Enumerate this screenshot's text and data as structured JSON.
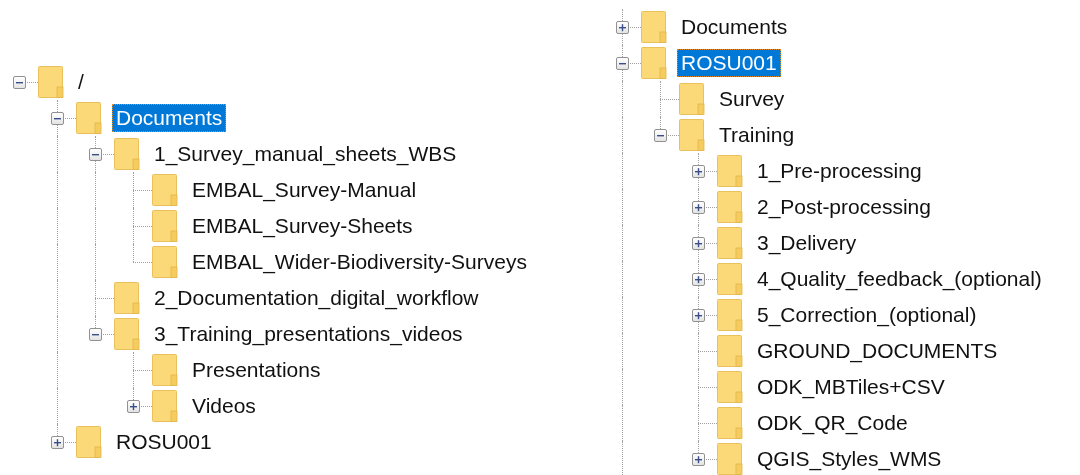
{
  "panes": [
    {
      "tree": [
        {
          "label": "/",
          "expanded": true,
          "selected": false,
          "children": [
            {
              "label": "Documents",
              "expanded": true,
              "selected": true,
              "children": [
                {
                  "label": "1_Survey_manual_sheets_WBS",
                  "expanded": true,
                  "selected": false,
                  "children": [
                    {
                      "label": "EMBAL_Survey-Manual",
                      "selected": false
                    },
                    {
                      "label": "EMBAL_Survey-Sheets",
                      "selected": false
                    },
                    {
                      "label": "EMBAL_Wider-Biodiversity-Surveys",
                      "selected": false
                    }
                  ]
                },
                {
                  "label": "2_Documentation_digital_workflow",
                  "selected": false
                },
                {
                  "label": "3_Training_presentations_videos",
                  "expanded": true,
                  "selected": false,
                  "children": [
                    {
                      "label": "Presentations",
                      "selected": false
                    },
                    {
                      "label": "Videos",
                      "expanded": false,
                      "selected": false
                    }
                  ]
                }
              ]
            },
            {
              "label": "ROSU001",
              "expanded": false,
              "selected": false
            }
          ]
        }
      ]
    },
    {
      "tree": [
        {
          "label": "Documents",
          "expanded": false,
          "selected": false
        },
        {
          "label": "ROSU001",
          "expanded": true,
          "selected": true,
          "children": [
            {
              "label": "Survey",
              "selected": false
            },
            {
              "label": "Training",
              "expanded": true,
              "selected": false,
              "children": [
                {
                  "label": "1_Pre-processing",
                  "expanded": false,
                  "selected": false
                },
                {
                  "label": "2_Post-processing",
                  "expanded": false,
                  "selected": false
                },
                {
                  "label": "3_Delivery",
                  "expanded": false,
                  "selected": false
                },
                {
                  "label": "4_Quality_feedback_(optional)",
                  "expanded": false,
                  "selected": false
                },
                {
                  "label": "5_Correction_(optional)",
                  "expanded": false,
                  "selected": false
                },
                {
                  "label": "GROUND_DOCUMENTS",
                  "selected": false
                },
                {
                  "label": "ODK_MBTiles+CSV",
                  "selected": false
                },
                {
                  "label": "ODK_QR_Code",
                  "selected": false
                },
                {
                  "label": "QGIS_Styles_WMS",
                  "expanded": false,
                  "selected": false
                }
              ]
            }
          ]
        }
      ]
    }
  ]
}
